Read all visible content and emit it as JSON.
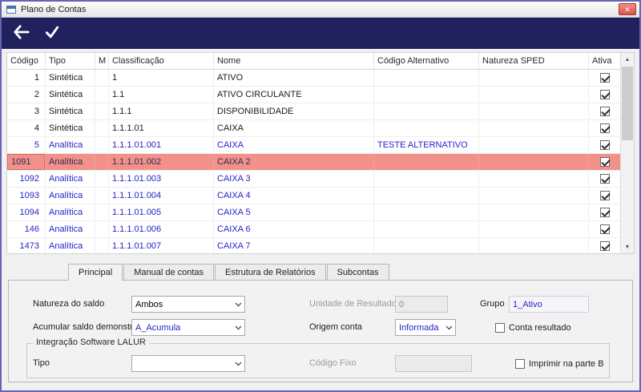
{
  "colors": {
    "toolbar_bg": "#21215e",
    "window_border": "#6464b4",
    "selected_row_bg": "#f2918a",
    "analitica_text": "#2424c9",
    "close_button_bg": "#d9544a"
  },
  "window": {
    "title": "Plano de Contas",
    "close_icon": "✕"
  },
  "toolbar": {
    "back_icon": "left-arrow",
    "confirm_icon": "checkmark"
  },
  "grid": {
    "columns": [
      "Código",
      "Tipo",
      "M",
      "Classificação",
      "Nome",
      "Código Alternativo",
      "Natureza SPED",
      "Ativa"
    ],
    "rows": [
      {
        "codigo": "1",
        "tipo": "Sintética",
        "m": "",
        "classificacao": "1",
        "nome": "ATIVO",
        "codigo_alternativo": "",
        "natureza_sped": "",
        "ativa": true,
        "analitica": false,
        "selected": false
      },
      {
        "codigo": "2",
        "tipo": "Sintética",
        "m": "",
        "classificacao": "1.1",
        "nome": "ATIVO CIRCULANTE",
        "codigo_alternativo": "",
        "natureza_sped": "",
        "ativa": true,
        "analitica": false,
        "selected": false
      },
      {
        "codigo": "3",
        "tipo": "Sintética",
        "m": "",
        "classificacao": "1.1.1",
        "nome": "DISPONIBILIDADE",
        "codigo_alternativo": "",
        "natureza_sped": "",
        "ativa": true,
        "analitica": false,
        "selected": false
      },
      {
        "codigo": "4",
        "tipo": "Sintética",
        "m": "",
        "classificacao": "1.1.1.01",
        "nome": "CAIXA",
        "codigo_alternativo": "",
        "natureza_sped": "",
        "ativa": true,
        "analitica": false,
        "selected": false
      },
      {
        "codigo": "5",
        "tipo": "Analítica",
        "m": "",
        "classificacao": "1.1.1.01.001",
        "nome": "CAIXA",
        "codigo_alternativo": "TESTE ALTERNATIVO",
        "natureza_sped": "",
        "ativa": true,
        "analitica": true,
        "selected": false
      },
      {
        "codigo": "1091",
        "tipo": "Analítica",
        "m": "",
        "classificacao": "1.1.1.01.002",
        "nome": "CAIXA 2",
        "codigo_alternativo": "",
        "natureza_sped": "",
        "ativa": true,
        "analitica": true,
        "selected": true
      },
      {
        "codigo": "1092",
        "tipo": "Analítica",
        "m": "",
        "classificacao": "1.1.1.01.003",
        "nome": "CAIXA 3",
        "codigo_alternativo": "",
        "natureza_sped": "",
        "ativa": true,
        "analitica": true,
        "selected": false
      },
      {
        "codigo": "1093",
        "tipo": "Analítica",
        "m": "",
        "classificacao": "1.1.1.01.004",
        "nome": "CAIXA 4",
        "codigo_alternativo": "",
        "natureza_sped": "",
        "ativa": true,
        "analitica": true,
        "selected": false
      },
      {
        "codigo": "1094",
        "tipo": "Analítica",
        "m": "",
        "classificacao": "1.1.1.01.005",
        "nome": "CAIXA 5",
        "codigo_alternativo": "",
        "natureza_sped": "",
        "ativa": true,
        "analitica": true,
        "selected": false
      },
      {
        "codigo": "146",
        "tipo": "Analítica",
        "m": "",
        "classificacao": "1.1.1.01.006",
        "nome": "CAIXA 6",
        "codigo_alternativo": "",
        "natureza_sped": "",
        "ativa": true,
        "analitica": true,
        "selected": false
      },
      {
        "codigo": "1473",
        "tipo": "Analítica",
        "m": "",
        "classificacao": "1.1.1.01.007",
        "nome": "CAIXA 7",
        "codigo_alternativo": "",
        "natureza_sped": "",
        "ativa": true,
        "analitica": true,
        "selected": false
      }
    ]
  },
  "tabs": [
    {
      "label": "Principal",
      "active": true
    },
    {
      "label": "Manual de contas",
      "active": false
    },
    {
      "label": "Estrutura de Relatórios",
      "active": false
    },
    {
      "label": "Subcontas",
      "active": false
    }
  ],
  "form": {
    "natureza_saldo": {
      "label": "Natureza do saldo",
      "value": "Ambos"
    },
    "unidade_resultado": {
      "label": "Unidade de Resultado",
      "value": "0"
    },
    "grupo": {
      "label": "Grupo",
      "value": "1_Ativo"
    },
    "acumular_saldo": {
      "label": "Acumular saldo demonstrativo",
      "value": "A_Acumula"
    },
    "origem_conta": {
      "label": "Origem conta",
      "value": "Informada"
    },
    "conta_resultado": {
      "label": "Conta resultado",
      "checked": false
    },
    "lalur": {
      "title": "Integração Software LALUR",
      "tipo": {
        "label": "Tipo",
        "value": ""
      },
      "codigo_fixo": {
        "label": "Código Fixo",
        "value": ""
      },
      "imprimir_parte_b": {
        "label": "Imprimir na parte B",
        "checked": false
      }
    }
  },
  "scrollbar": {
    "up_icon": "▲",
    "down_icon": "▼"
  }
}
